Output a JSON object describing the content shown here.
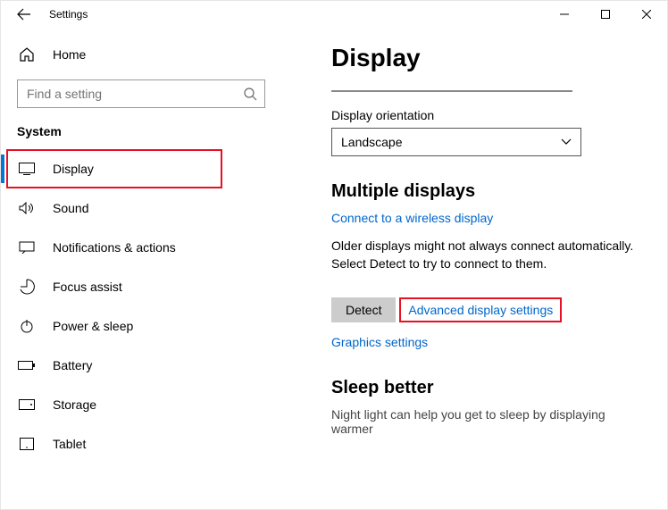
{
  "titlebar": {
    "title": "Settings"
  },
  "sidebar": {
    "home_label": "Home",
    "search_placeholder": "Find a setting",
    "section": "System",
    "items": [
      {
        "label": "Display"
      },
      {
        "label": "Sound"
      },
      {
        "label": "Notifications & actions"
      },
      {
        "label": "Focus assist"
      },
      {
        "label": "Power & sleep"
      },
      {
        "label": "Battery"
      },
      {
        "label": "Storage"
      },
      {
        "label": "Tablet"
      }
    ]
  },
  "main": {
    "title": "Display",
    "orientation_label": "Display orientation",
    "orientation_value": "Landscape",
    "multi_heading": "Multiple displays",
    "wireless_link": "Connect to a wireless display",
    "detect_desc": "Older displays might not always connect automatically. Select Detect to try to connect to them.",
    "detect_button": "Detect",
    "advanced_link": "Advanced display settings",
    "graphics_link": "Graphics settings",
    "sleep_heading": "Sleep better",
    "sleep_desc": "Night light can help you get to sleep by displaying warmer"
  }
}
